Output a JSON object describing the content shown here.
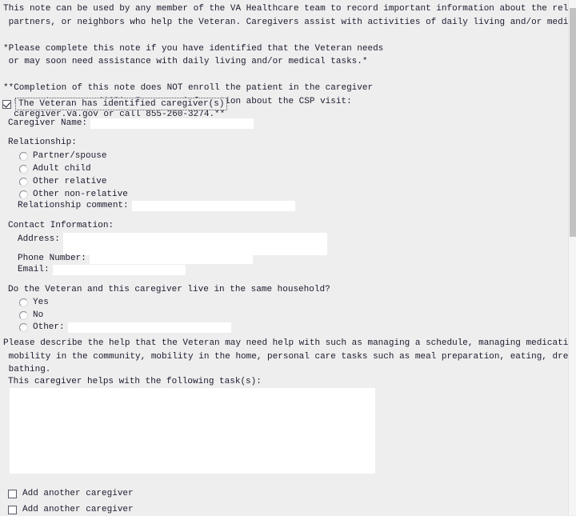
{
  "intro": {
    "line1": "This note can be used by any member of the VA Healthcare team to record important information about the relatives,",
    "line2": " partners, or neighbors who help the Veteran. Caregivers assist with activities of daily living and/or medical tasks.",
    "line3": "*Please complete this note if you have identified that the Veteran needs",
    "line4": " or may soon need assistance with daily living and/or medical tasks.*",
    "line5": "**Completion of this note does NOT enroll the patient in the caregiver",
    "line6": "  support program (CSP). For more information about the CSP visit:",
    "line7": "  caregiver.va.gov or call 855-260-3274.**"
  },
  "identified": {
    "checkbox_checked": true,
    "label": "The Veteran has identified caregiver(s)"
  },
  "caregiver_name": {
    "label": "Caregiver Name:",
    "value": "",
    "placeholder": ""
  },
  "relationship": {
    "label": "Relationship:",
    "options": [
      {
        "label": "Partner/spouse",
        "selected": false
      },
      {
        "label": "Adult child",
        "selected": false
      },
      {
        "label": "Other relative",
        "selected": false
      },
      {
        "label": "Other non-relative",
        "selected": false
      }
    ],
    "comment_label": "Relationship comment:",
    "comment_value": "",
    "comment_placeholder": ""
  },
  "contact": {
    "heading": "Contact Information:",
    "address_label": "Address:",
    "address_value": "",
    "address_placeholder": "",
    "phone_label": "Phone Number:",
    "phone_value": "",
    "phone_placeholder": "",
    "email_label": "Email:",
    "email_value": "",
    "email_placeholder": ""
  },
  "household": {
    "question": "Do the Veteran and this caregiver live in the same household?",
    "options": [
      {
        "label": "Yes",
        "selected": false
      },
      {
        "label": "No",
        "selected": false
      },
      {
        "label": "Other:",
        "selected": false
      }
    ],
    "other_value": "",
    "other_placeholder": ""
  },
  "describe": {
    "line1": "Please describe the help that the Veteran may need help with such as managing a schedule, managing medications,",
    "line2": " mobility in the community, mobility in the home, personal care tasks such as meal preparation, eating, dressing or",
    "line3": " bathing."
  },
  "tasks": {
    "label": "This caregiver helps with the following task(s):",
    "value": "",
    "placeholder": ""
  },
  "add_more": [
    {
      "label": "Add another caregiver",
      "checked": false
    },
    {
      "label": "Add another caregiver",
      "checked": false
    }
  ],
  "scrollbar": {
    "orientation": "vertical"
  },
  "colors": {
    "page_bg": "#eeeeee",
    "text": "#1b1b2f",
    "field_bg": "#ffffff",
    "scroll_thumb": "#c2c2c2"
  }
}
